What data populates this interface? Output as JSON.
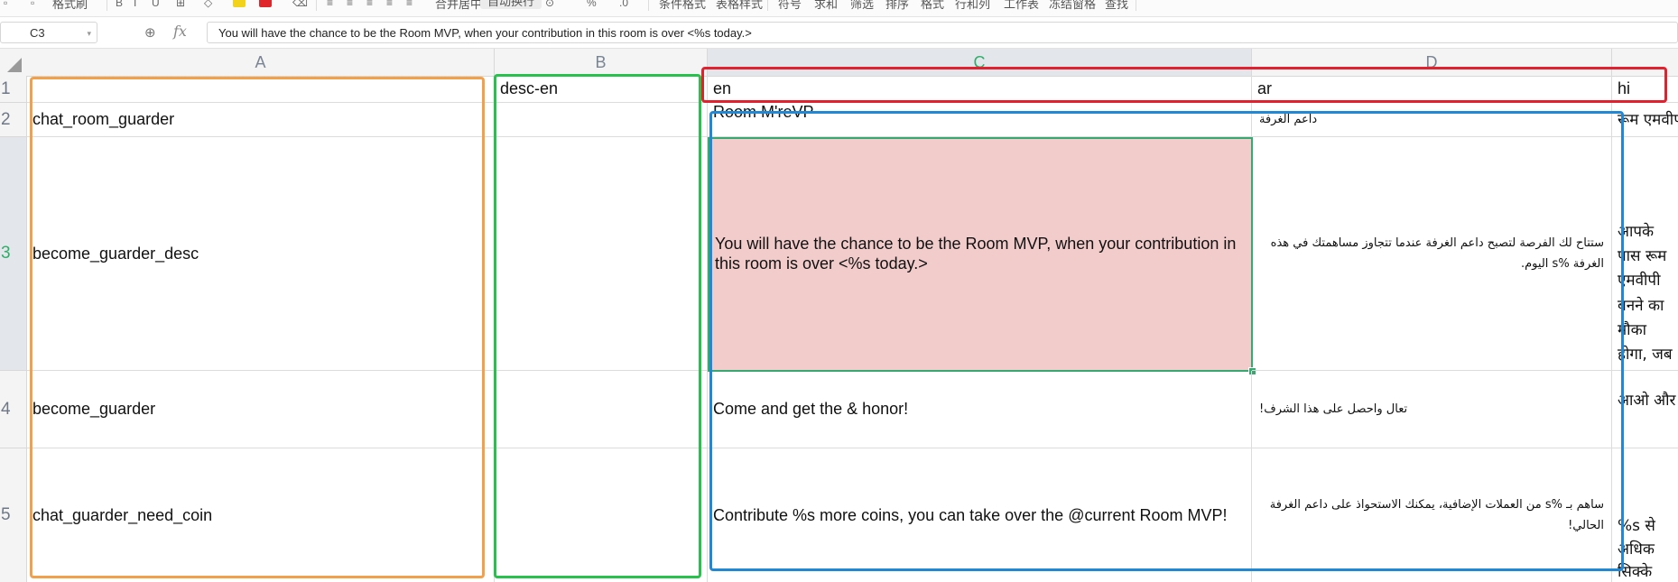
{
  "toolbar": {
    "items": [
      "格式刷",
      "合并居中",
      "自动换行",
      "条件格式",
      "表格样式",
      "符号",
      "求和",
      "筛选",
      "排序",
      "格式",
      "行和列",
      "工作表",
      "冻结窗格",
      "查找"
    ],
    "swatch_yellow": "#f2d21b",
    "swatch_red": "#e0262b"
  },
  "formula_bar": {
    "cell_ref": "C3",
    "zoom_icon": "zoom-icon",
    "fx_label": "fx",
    "content": "You will have the chance to be the Room MVP, when your contribution in this room is over <%s today.>"
  },
  "columns": [
    "A",
    "B",
    "C",
    "D"
  ],
  "rows": [
    "1",
    "2",
    "3",
    "4",
    "5"
  ],
  "cells": {
    "r1": {
      "a": "",
      "b": "desc-en",
      "c": "en",
      "d": "ar",
      "e": "hi"
    },
    "r2": {
      "a": "chat_room_guarder",
      "b": "",
      "c": "Room M'reVP",
      "d": "داعم الغرفة",
      "e": "रूम एमवीपी"
    },
    "r3": {
      "a": "become_guarder_desc",
      "b": "",
      "c": "You will have the chance to be the Room MVP, when your contribution in this room is over <%s today.>",
      "d": "ستتاح لك الفرصة لتصبح داعم الغرفة عندما تتجاوز مساهمتك في هذه الغرفة %s اليوم.",
      "e": "आपके पास रूम एमवीपी बनने का मौका होगा, जब आज इस रूम में आपका योगदान %s से अधिक है।"
    },
    "r4": {
      "a": "become_guarder",
      "b": "",
      "c": "Come and get the & honor!",
      "d": "تعال واحصل على هذا الشرف!",
      "e": "आओ और सम्मान पाओ!"
    },
    "r5": {
      "a": "chat_guarder_need_coin",
      "b": "",
      "c": "Contribute %s more coins, you can take over the @current Room MVP!",
      "d": "ساهم بـ %s من العملات الإضافية، يمكنك الاستحواذ على داعم الغرفة الحالي!",
      "e": "%s से अधिक सिक्के योगदान करें, आप वर्तमान रूम एमवीपी ले सकते हैं!"
    }
  },
  "annotation_colors": {
    "orange": "#f2a14a",
    "green": "#27c24c",
    "red": "#e2202e",
    "blue": "#2188d6"
  }
}
